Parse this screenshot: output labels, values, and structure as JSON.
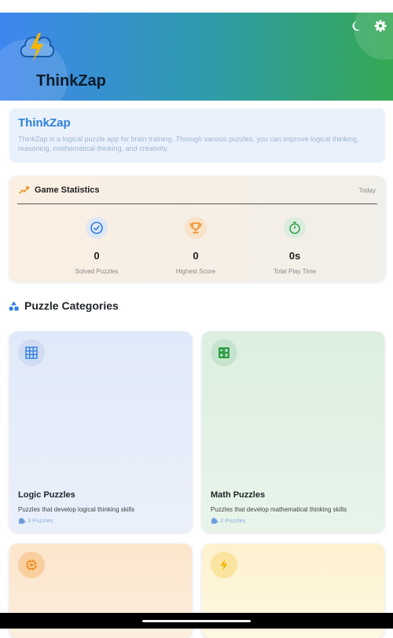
{
  "app": {
    "title": "ThinkZap"
  },
  "info": {
    "title": "ThinkZap",
    "description": "ThinkZap is a logical puzzle app for brain training. Through various puzzles, you can improve logical thinking, reasoning, mathematical thinking, and creativity."
  },
  "stats": {
    "title": "Game Statistics",
    "period": "Today",
    "items": [
      {
        "value": "0",
        "label": "Solved Puzzles",
        "icon": "check-circle-icon",
        "color": "#2f7de1"
      },
      {
        "value": "0",
        "label": "Highest Score",
        "icon": "trophy-icon",
        "color": "#f08c1a"
      },
      {
        "value": "0s",
        "label": "Total Play Time",
        "icon": "timer-icon",
        "color": "#2e9e46"
      }
    ]
  },
  "categories": {
    "title": "Puzzle Categories",
    "items": [
      {
        "title": "Logic Puzzles",
        "description": "Puzzles that develop logical thinking skills",
        "count": "3 Puzzles",
        "icon": "grid-icon",
        "color": "#2f7de1"
      },
      {
        "title": "Math Puzzles",
        "description": "Puzzles that develop mathematical thinking skills",
        "count": "2 Puzzles",
        "icon": "calculator-icon",
        "color": "#2e9e46"
      },
      {
        "title": "",
        "description": "",
        "count": "",
        "icon": "chip-icon",
        "color": "#f08c1a"
      },
      {
        "title": "",
        "description": "",
        "count": "",
        "icon": "lightning-icon",
        "color": "#f2b705"
      }
    ]
  }
}
